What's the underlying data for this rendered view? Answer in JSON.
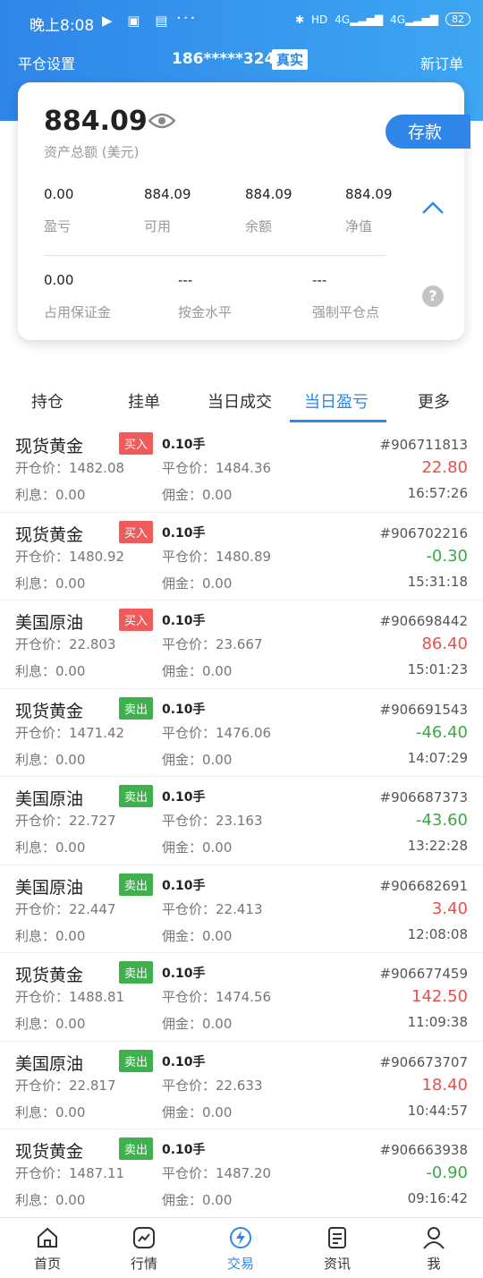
{
  "status": {
    "time": "晚上8:08",
    "battery": "82",
    "net1": "4G",
    "net2": "4G",
    "hd": "HD"
  },
  "header": {
    "left": "平仓设置",
    "account": "186*****324",
    "account_type": "真实",
    "right": "新订单"
  },
  "summary": {
    "total": "884.09",
    "total_label": "资产总额 (美元)",
    "deposit": "存款",
    "stats": [
      {
        "value": "0.00",
        "label": "盈亏"
      },
      {
        "value": "884.09",
        "label": "可用"
      },
      {
        "value": "884.09",
        "label": "余额"
      },
      {
        "value": "884.09",
        "label": "净值"
      }
    ],
    "stats2": [
      {
        "value": "0.00",
        "label": "占用保证金"
      },
      {
        "value": "---",
        "label": "按金水平"
      },
      {
        "value": "---",
        "label": "强制平仓点"
      }
    ]
  },
  "tabs": [
    "持仓",
    "挂单",
    "当日成交",
    "当日盈亏",
    "更多"
  ],
  "active_tab": "当日盈亏",
  "colors": {
    "accent": "#2f86e8",
    "buy": "#ef5a5a",
    "sell": "#3fb04d",
    "profit": "#e8504a",
    "loss": "#3aa945"
  },
  "trades": [
    {
      "name": "现货黄金",
      "side": "买入",
      "side_type": "buy",
      "lots": "0.10手",
      "id": "#906711813",
      "open": "开仓价：1482.08",
      "close": "平仓价：1484.36",
      "pl": "22.80",
      "pl_type": "profit",
      "interest": "利息：0.00",
      "commission": "佣金：0.00",
      "time": "16:57:26"
    },
    {
      "name": "现货黄金",
      "side": "买入",
      "side_type": "buy",
      "lots": "0.10手",
      "id": "#906702216",
      "open": "开仓价：1480.92",
      "close": "平仓价：1480.89",
      "pl": "-0.30",
      "pl_type": "loss",
      "interest": "利息：0.00",
      "commission": "佣金：0.00",
      "time": "15:31:18"
    },
    {
      "name": "美国原油",
      "side": "买入",
      "side_type": "buy",
      "lots": "0.10手",
      "id": "#906698442",
      "open": "开仓价：22.803",
      "close": "平仓价：23.667",
      "pl": "86.40",
      "pl_type": "profit",
      "interest": "利息：0.00",
      "commission": "佣金：0.00",
      "time": "15:01:23"
    },
    {
      "name": "现货黄金",
      "side": "卖出",
      "side_type": "sell",
      "lots": "0.10手",
      "id": "#906691543",
      "open": "开仓价：1471.42",
      "close": "平仓价：1476.06",
      "pl": "-46.40",
      "pl_type": "loss",
      "interest": "利息：0.00",
      "commission": "佣金：0.00",
      "time": "14:07:29"
    },
    {
      "name": "美国原油",
      "side": "卖出",
      "side_type": "sell",
      "lots": "0.10手",
      "id": "#906687373",
      "open": "开仓价：22.727",
      "close": "平仓价：23.163",
      "pl": "-43.60",
      "pl_type": "loss",
      "interest": "利息：0.00",
      "commission": "佣金：0.00",
      "time": "13:22:28"
    },
    {
      "name": "美国原油",
      "side": "卖出",
      "side_type": "sell",
      "lots": "0.10手",
      "id": "#906682691",
      "open": "开仓价：22.447",
      "close": "平仓价：22.413",
      "pl": "3.40",
      "pl_type": "profit",
      "interest": "利息：0.00",
      "commission": "佣金：0.00",
      "time": "12:08:08"
    },
    {
      "name": "现货黄金",
      "side": "卖出",
      "side_type": "sell",
      "lots": "0.10手",
      "id": "#906677459",
      "open": "开仓价：1488.81",
      "close": "平仓价：1474.56",
      "pl": "142.50",
      "pl_type": "profit",
      "interest": "利息：0.00",
      "commission": "佣金：0.00",
      "time": "11:09:38"
    },
    {
      "name": "美国原油",
      "side": "卖出",
      "side_type": "sell",
      "lots": "0.10手",
      "id": "#906673707",
      "open": "开仓价：22.817",
      "close": "平仓价：22.633",
      "pl": "18.40",
      "pl_type": "profit",
      "interest": "利息：0.00",
      "commission": "佣金：0.00",
      "time": "10:44:57"
    },
    {
      "name": "现货黄金",
      "side": "卖出",
      "side_type": "sell",
      "lots": "0.10手",
      "id": "#906663938",
      "open": "开仓价：1487.11",
      "close": "平仓价：1487.20",
      "pl": "-0.90",
      "pl_type": "loss",
      "interest": "利息：0.00",
      "commission": "佣金：0.00",
      "time": "09:16:42"
    }
  ],
  "nav": [
    {
      "label": "首页",
      "icon": "home-icon"
    },
    {
      "label": "行情",
      "icon": "market-icon"
    },
    {
      "label": "交易",
      "icon": "trade-icon"
    },
    {
      "label": "资讯",
      "icon": "news-icon"
    },
    {
      "label": "我",
      "icon": "user-icon"
    }
  ],
  "active_nav": "交易"
}
